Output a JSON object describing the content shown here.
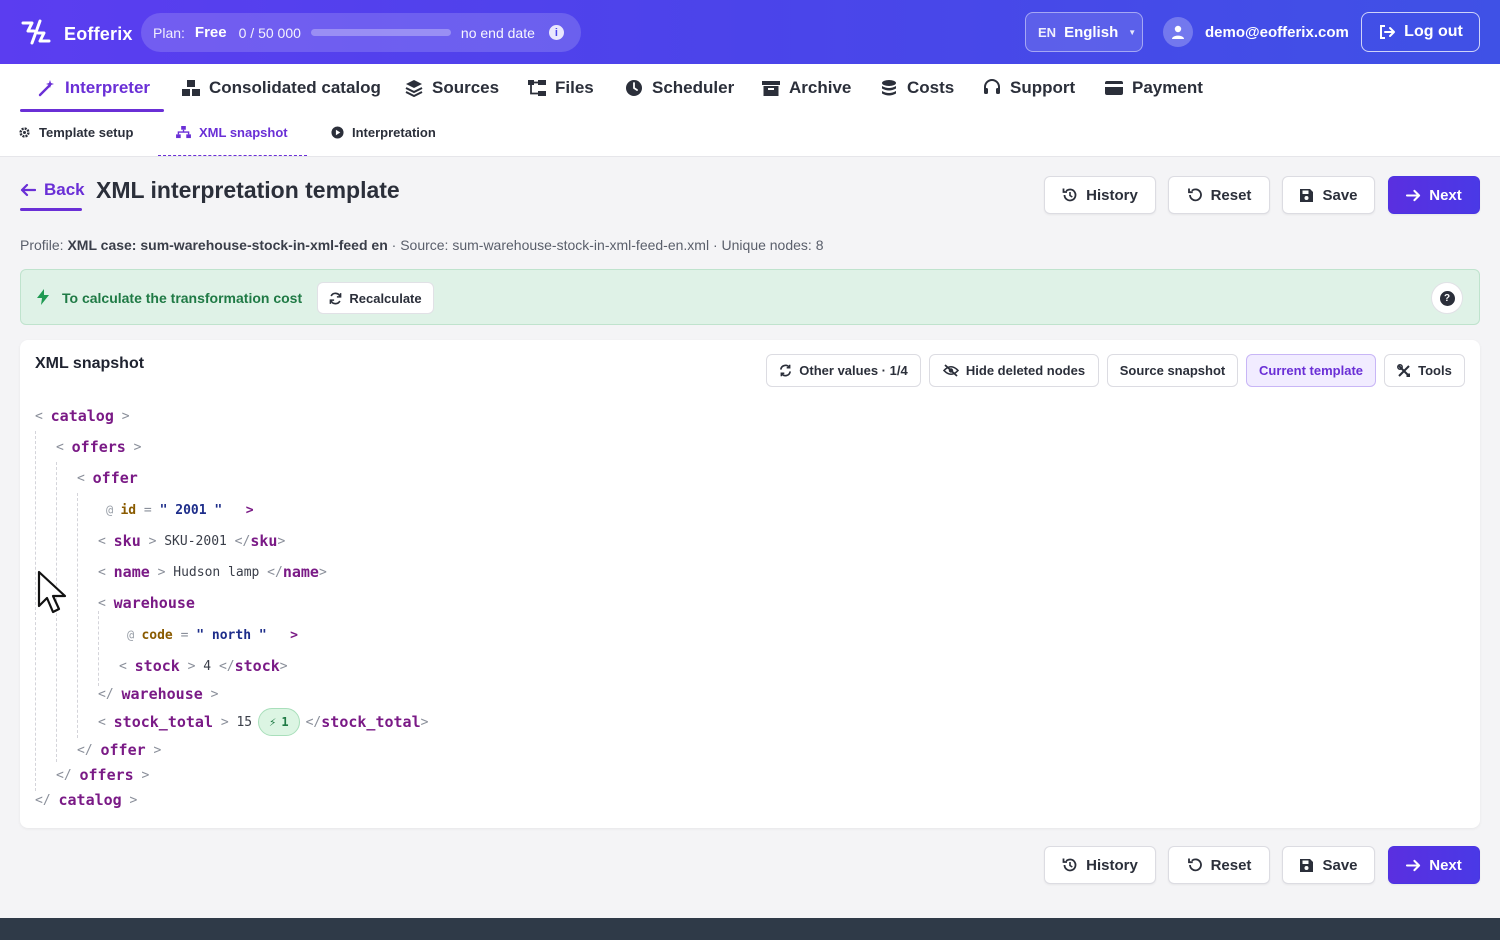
{
  "app": {
    "name": "Eofferix"
  },
  "plan": {
    "label": "Plan:",
    "name": "Free",
    "used": "0",
    "sep": "/",
    "limit": "50 000",
    "usage_fraction": 0.0,
    "end": "no end date",
    "info_icon": "info-icon"
  },
  "language": {
    "code": "EN",
    "name": "English"
  },
  "user": {
    "email": "demo@eofferix.com"
  },
  "logout": {
    "label": "Log out"
  },
  "main_nav": [
    {
      "label": "Interpreter",
      "icon": "magic-wand-icon",
      "active": true
    },
    {
      "label": "Consolidated catalog",
      "icon": "boxes-icon"
    },
    {
      "label": "Sources",
      "icon": "layers-icon"
    },
    {
      "label": "Files",
      "icon": "folder-tree-icon"
    },
    {
      "label": "Scheduler",
      "icon": "clock-icon"
    },
    {
      "label": "Archive",
      "icon": "archive-icon"
    },
    {
      "label": "Costs",
      "icon": "coins-icon"
    },
    {
      "label": "Support",
      "icon": "headset-icon"
    },
    {
      "label": "Payment",
      "icon": "credit-card-icon"
    }
  ],
  "sub_nav": [
    {
      "label": "Template setup",
      "icon": "gear-icon"
    },
    {
      "label": "XML snapshot",
      "icon": "sitemap-icon",
      "active": true
    },
    {
      "label": "Interpretation",
      "icon": "play-circle-icon"
    }
  ],
  "header": {
    "back": "Back",
    "title": "XML interpretation template"
  },
  "actions": {
    "history": "History",
    "reset": "Reset",
    "save": "Save",
    "next": "Next"
  },
  "meta": {
    "profile_label": "Profile:",
    "profile_value": "XML case: sum-warehouse-stock-in-xml-feed en",
    "source": "· Source: sum-warehouse-stock-in-xml-feed-en.xml",
    "nodes": "· Unique nodes: 8"
  },
  "banner": {
    "text": "To calculate the transformation cost",
    "recalc": "Recalculate",
    "colors": {
      "bg": "#dff2e7",
      "text": "#1f7a45"
    }
  },
  "panel": {
    "title": "XML snapshot",
    "tools": {
      "other_values": "Other values · 1/4",
      "hide_deleted": "Hide deleted nodes",
      "source_snapshot": "Source snapshot",
      "current_template": "Current template",
      "tools": "Tools"
    }
  },
  "xml": {
    "catalog": "catalog",
    "offers": "offers",
    "offer": "offer",
    "id_attr": "id",
    "id_val": "2001",
    "sku": "sku",
    "sku_val": "SKU-2001",
    "name": "name",
    "name_val": "Hudson lamp",
    "warehouse": "warehouse",
    "code_attr": "code",
    "code_val": "north",
    "stock": "stock",
    "stock_val": "4",
    "stock_total": "stock_total",
    "stock_total_val": "15",
    "rule_count": "1"
  },
  "colors": {
    "accent": "#6a2fd6",
    "primary": "#4a39e6",
    "tag": "#7a1a86"
  }
}
